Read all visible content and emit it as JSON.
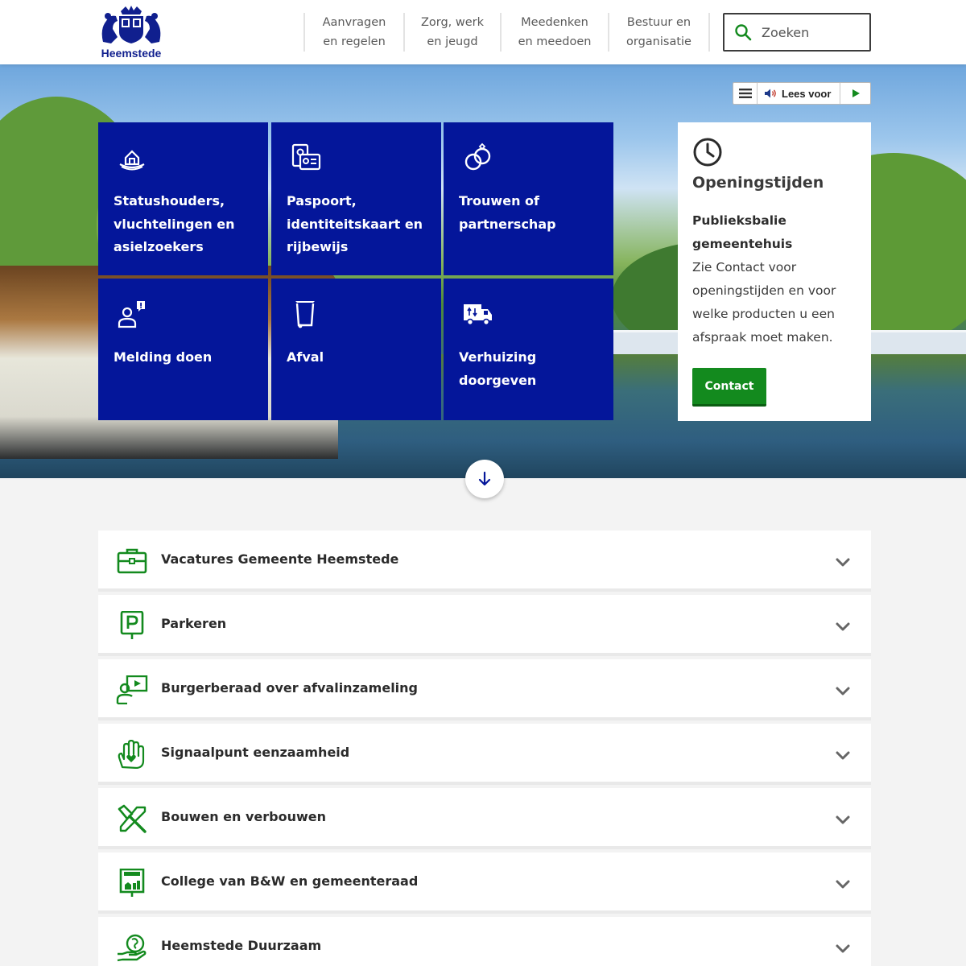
{
  "brand": {
    "name": "Heemstede",
    "primary": "#04169a",
    "accent_green": "#138a1e"
  },
  "nav": [
    {
      "line1": "Aanvragen",
      "line2": "en regelen"
    },
    {
      "line1": "Zorg, werk",
      "line2": "en jeugd"
    },
    {
      "line1": "Meedenken",
      "line2": "en meedoen"
    },
    {
      "line1": "Bestuur en",
      "line2": "organisatie"
    }
  ],
  "search": {
    "placeholder": "Zoeken",
    "icon": "search-icon"
  },
  "readspeaker": {
    "label": "Lees voor"
  },
  "tiles": [
    {
      "label": "Statushouders, vluchtelingen en asielzoekers",
      "icon": "shelter-icon"
    },
    {
      "label": "Paspoort, identiteitskaart en rijbewijs",
      "icon": "id-documents-icon"
    },
    {
      "label": "Trouwen of partnerschap",
      "icon": "rings-icon"
    },
    {
      "label": "Melding doen",
      "icon": "report-person-icon"
    },
    {
      "label": "Afval",
      "icon": "waste-bin-icon"
    },
    {
      "label": "Verhuizing doorgeven",
      "icon": "moving-truck-icon"
    }
  ],
  "opening": {
    "title": "Openingstijden",
    "subtitle": "Publieksbalie gemeentehuis",
    "body": "Zie Contact voor openingstijden en voor welke producten u een afspraak moet maken.",
    "button": "Contact"
  },
  "accordion": [
    {
      "label": "Vacatures Gemeente Heemstede",
      "icon": "briefcase-icon"
    },
    {
      "label": "Parkeren",
      "icon": "parking-sign-icon"
    },
    {
      "label": "Burgerberaad over afvalinzameling",
      "icon": "presentation-icon"
    },
    {
      "label": "Signaalpunt eenzaamheid",
      "icon": "helping-hand-icon"
    },
    {
      "label": "Bouwen en verbouwen",
      "icon": "hammer-icon"
    },
    {
      "label": "College van B&W en gemeenteraad",
      "icon": "welcome-sign-icon"
    },
    {
      "label": "Heemstede Duurzaam",
      "icon": "sustainability-hand-icon"
    }
  ]
}
